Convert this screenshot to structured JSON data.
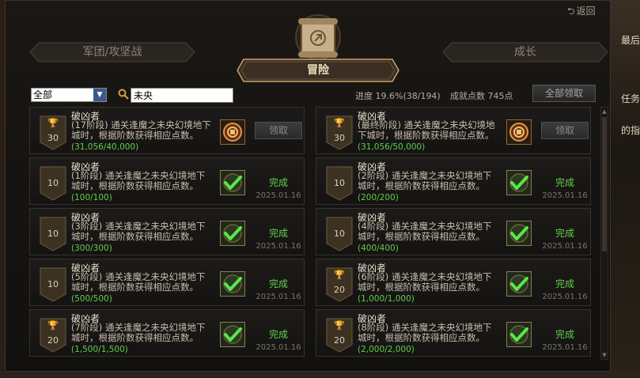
{
  "header": {
    "back_label": "返回"
  },
  "tabs": [
    {
      "label": "军团/攻坚战",
      "active": false
    },
    {
      "label": "冒险",
      "active": true
    },
    {
      "label": "成长",
      "active": false
    }
  ],
  "filter": {
    "selected": "全部",
    "search_value": "未央"
  },
  "summary": {
    "progress_label": "进度",
    "progress_text": "19.6%(38/194)",
    "points_label": "成就点数",
    "points_value": "745点",
    "claim_all_label": "全部领取"
  },
  "achievements": [
    {
      "title": "破凶者",
      "description": "(17阶段) 通关逢魔之未央幻境地下城时，根据阶数获得相应点数。",
      "progress": "(31,056/40,000)",
      "points": "30",
      "trophy": true,
      "status": "claim",
      "action_label": "领取",
      "date": ""
    },
    {
      "title": "破凶者",
      "description": "(最终阶段) 通关逢魔之未央幻境地下城时，根据阶数获得相应点数。",
      "progress": "(31,056/50,000)",
      "points": "30",
      "trophy": true,
      "status": "claim",
      "action_label": "领取",
      "date": ""
    },
    {
      "title": "破凶者",
      "description": "(1阶段) 通关逢魔之未央幻境地下城时，根据阶数获得相应点数。",
      "progress": "(100/100)",
      "points": "10",
      "trophy": false,
      "status": "done",
      "action_label": "完成",
      "date": "2025.01.16"
    },
    {
      "title": "破凶者",
      "description": "(2阶段) 通关逢魔之未央幻境地下城时，根据阶数获得相应点数。",
      "progress": "(200/200)",
      "points": "10",
      "trophy": false,
      "status": "done",
      "action_label": "完成",
      "date": "2025.01.16"
    },
    {
      "title": "破凶者",
      "description": "(3阶段) 通关逢魔之未央幻境地下城时，根据阶数获得相应点数。",
      "progress": "(300/300)",
      "points": "10",
      "trophy": false,
      "status": "done",
      "action_label": "完成",
      "date": "2025.01.16"
    },
    {
      "title": "破凶者",
      "description": "(4阶段) 通关逢魔之未央幻境地下城时，根据阶数获得相应点数。",
      "progress": "(400/400)",
      "points": "10",
      "trophy": false,
      "status": "done",
      "action_label": "完成",
      "date": "2025.01.16"
    },
    {
      "title": "破凶者",
      "description": "(5阶段) 通关逢魔之未央幻境地下城时，根据阶数获得相应点数。",
      "progress": "(500/500)",
      "points": "10",
      "trophy": false,
      "status": "done",
      "action_label": "完成",
      "date": "2025.01.16"
    },
    {
      "title": "破凶者",
      "description": "(6阶段) 通关逢魔之未央幻境地下城时，根据阶数获得相应点数。",
      "progress": "(1,000/1,000)",
      "points": "20",
      "trophy": true,
      "status": "done",
      "action_label": "完成",
      "date": "2025.01.16"
    },
    {
      "title": "破凶者",
      "description": "(7阶段) 通关逢魔之未央幻境地下城时，根据阶数获得相应点数。",
      "progress": "(1,500/1,500)",
      "points": "20",
      "trophy": true,
      "status": "done",
      "action_label": "完成",
      "date": "2025.01.16"
    },
    {
      "title": "破凶者",
      "description": "(8阶段) 通关逢魔之未央幻境地下城时，根据阶数获得相应点数。",
      "progress": "(2,000/2,000)",
      "points": "20",
      "trophy": true,
      "status": "done",
      "action_label": "完成",
      "date": "2025.01.16"
    }
  ],
  "background_snippets": [
    "最后",
    "任务",
    "的指"
  ],
  "colors": {
    "done_green": "#61d24a",
    "progress_green": "#5fce4b",
    "accent_gold": "#c9a46a"
  }
}
